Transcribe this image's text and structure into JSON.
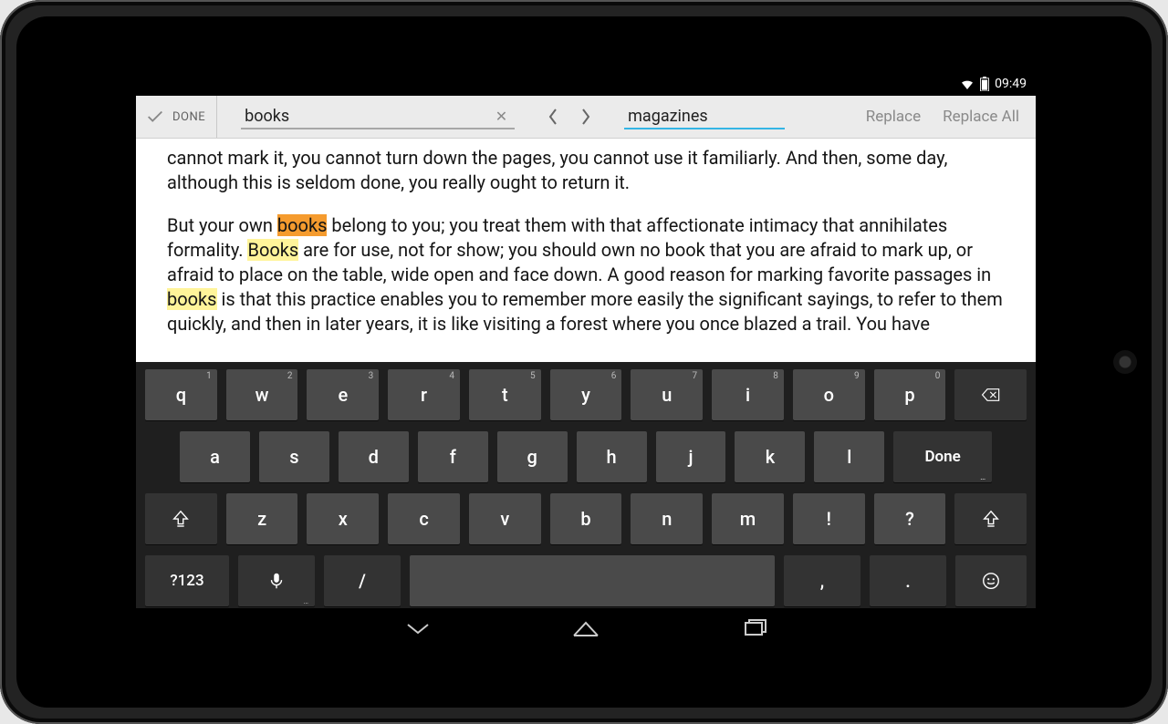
{
  "status": {
    "time": "09:49"
  },
  "toolbar": {
    "done_label": "DONE",
    "search_value": "books",
    "replace_value": "magazines",
    "replace_btn": "Replace",
    "replace_all_btn": "Replace All"
  },
  "doc": {
    "p1_a": "cannot mark it, you cannot turn down the pages, you cannot use it familiarly. And then, some day, although this is seldom done, you really ought to return it.",
    "p2_lead": "But your own ",
    "p2_hl1": "books",
    "p2_mid1": " belong to you; you treat them with that affectionate intimacy that annihilates formality. ",
    "p2_hl2": "Books",
    "p2_mid2": " are for use, not for show; you should own no book that you are afraid to mark up, or afraid to place on the table, wide open and face down. A good reason for marking favorite passages in ",
    "p2_hl3": "books",
    "p2_end": " is that this practice enables you to remember more easily the significant sayings, to refer to them quickly, and then in later years, it is like visiting a forest where you once blazed a trail. You have"
  },
  "kbd": {
    "r1": [
      {
        "k": "q",
        "s": "1"
      },
      {
        "k": "w",
        "s": "2"
      },
      {
        "k": "e",
        "s": "3"
      },
      {
        "k": "r",
        "s": "4"
      },
      {
        "k": "t",
        "s": "5"
      },
      {
        "k": "y",
        "s": "6"
      },
      {
        "k": "u",
        "s": "7"
      },
      {
        "k": "i",
        "s": "8"
      },
      {
        "k": "o",
        "s": "9"
      },
      {
        "k": "p",
        "s": "0"
      }
    ],
    "r2": [
      "a",
      "s",
      "d",
      "f",
      "g",
      "h",
      "j",
      "k",
      "l"
    ],
    "r2_done": "Done",
    "r3": [
      "z",
      "x",
      "c",
      "v",
      "b",
      "n",
      "m",
      "!",
      "?"
    ],
    "r4": {
      "sym": "?123",
      "slash": "/",
      "comma": ",",
      "period": "."
    }
  }
}
